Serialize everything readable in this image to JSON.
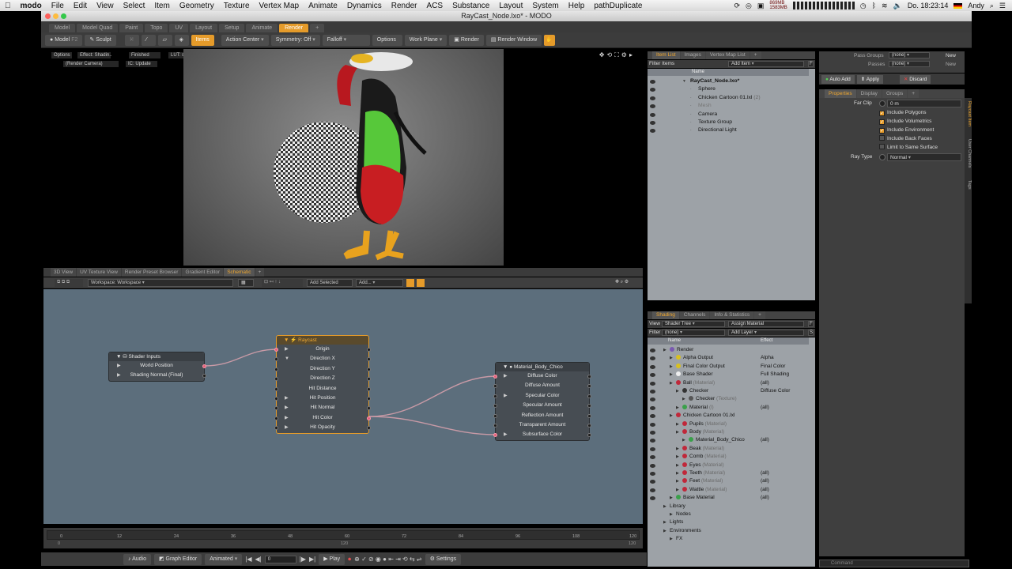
{
  "menubar": {
    "app": "modo",
    "items": [
      "File",
      "Edit",
      "View",
      "Select",
      "Item",
      "Geometry",
      "Texture",
      "Vertex Map",
      "Animate",
      "Dynamics",
      "Render",
      "ACS",
      "Substance",
      "Layout",
      "System",
      "Help",
      "pathDuplicate"
    ],
    "stat_top": "869MB",
    "stat_bottom": "1583MB",
    "clock": "Do. 18:23:14",
    "user": "Andy"
  },
  "window": {
    "title": "RayCast_Node.lxo* - MODO"
  },
  "mode_tabs": [
    "Model",
    "Model Quad",
    "Paint",
    "Topo",
    "UV",
    "Layout",
    "Setup",
    "Animate",
    "Render"
  ],
  "toolbar": {
    "model": "Model",
    "model_key": "F2",
    "sculpt": "Sculpt",
    "items": "Items",
    "action_center": "Action Center",
    "symmetry": "Symmetry: Off",
    "falloff": "Falloff",
    "options": "Options",
    "work_plane": "Work Plane",
    "render": "Render",
    "render_window": "Render Window"
  },
  "viewport": {
    "options": "Options",
    "effect": "Effect: Shadin..",
    "finished": "Finished",
    "lut": "LUT: sRGB",
    "camera": "(Render Camera)",
    "ic": "IC: Update"
  },
  "schematic_tabs": [
    "3D View",
    "UV Texture View",
    "Render Preset Browser",
    "Gradient Editor",
    "Schematic"
  ],
  "schematic_toolbar": {
    "workspace": "Workspace: Workspace",
    "add_selected": "Add Selected",
    "add": "Add..."
  },
  "nodes": {
    "shader_inputs": {
      "title": "Shader Inputs",
      "rows": [
        "World Position",
        "Shading Normal (Final)"
      ]
    },
    "raycast": {
      "title": "Raycast",
      "rows": [
        "Origin",
        "Direction X",
        "Direction Y",
        "Direction Z",
        "Hit Distance",
        "Hit Position",
        "Hit Normal",
        "Hit Color",
        "Hit Opacity"
      ]
    },
    "material": {
      "title": "Material_Body_Chico",
      "rows": [
        "Diffuse Color",
        "Diffuse Amount",
        "Specular Color",
        "Specular Amount",
        "Reflection Amount",
        "Transparent Amount",
        "Subsurface Color"
      ]
    }
  },
  "timeline": {
    "ticks": [
      "0",
      "12",
      "24",
      "36",
      "48",
      "60",
      "72",
      "84",
      "96",
      "108",
      "120"
    ],
    "bottom_ticks": [
      "0",
      "120",
      "120"
    ]
  },
  "transport": {
    "audio": "Audio",
    "graph_editor": "Graph Editor",
    "animated": "Animated",
    "frame": "0",
    "play": "Play",
    "settings": "Settings"
  },
  "item_list": {
    "tabs": [
      "Item List",
      "Images",
      "Vertex Map List"
    ],
    "filter": "Filter Items",
    "add_item": "Add Item",
    "name_header": "Name",
    "rows": [
      {
        "name": "RayCast_Node.lxo*",
        "sub": "",
        "bold": true,
        "indent": 0
      },
      {
        "name": "Sphere",
        "sub": "",
        "indent": 1
      },
      {
        "name": "Chicken Cartoon 01.lxl",
        "sub": "(2)",
        "indent": 1
      },
      {
        "name": "Mesh",
        "sub": "",
        "indent": 1,
        "dim": true
      },
      {
        "name": "Camera",
        "sub": "",
        "indent": 1
      },
      {
        "name": "Texture Group",
        "sub": "",
        "indent": 1
      },
      {
        "name": "Directional Light",
        "sub": "",
        "indent": 1
      }
    ]
  },
  "shading": {
    "tabs": [
      "Shading",
      "Channels",
      "Info & Statistics"
    ],
    "view_label": "View",
    "view_value": "Shader Tree",
    "assign": "Assign Material",
    "filter_label": "Filter",
    "filter_value": "(none)",
    "add_layer": "Add Layer",
    "name_header": "Name",
    "effect_header": "Effect",
    "rows": [
      {
        "name": "Render",
        "sub": "",
        "effect": "",
        "indent": 0,
        "color": "#7a5ab0"
      },
      {
        "name": "Alpha Output",
        "sub": "",
        "effect": "Alpha",
        "indent": 1,
        "color": "#d9c020"
      },
      {
        "name": "Final Color Output",
        "sub": "",
        "effect": "Final Color",
        "indent": 1,
        "color": "#d9c020"
      },
      {
        "name": "Base Shader",
        "sub": "",
        "effect": "Full Shading",
        "indent": 1,
        "color": "#eeeeee"
      },
      {
        "name": "Ball",
        "sub": "(Material)",
        "effect": "(all)",
        "indent": 1,
        "color": "#c0283a"
      },
      {
        "name": "Checker",
        "sub": "",
        "effect": "Diffuse Color",
        "indent": 2,
        "color": "#333333"
      },
      {
        "name": "Checker",
        "sub": "(Texture)",
        "effect": "",
        "indent": 3,
        "color": "#555555"
      },
      {
        "name": "Material",
        "sub": "(l)",
        "effect": "(all)",
        "indent": 2,
        "color": "#3aa04a"
      },
      {
        "name": "Chicken Cartoon 01.lxl",
        "sub": "",
        "effect": "",
        "indent": 1,
        "color": "#c0283a"
      },
      {
        "name": "Pupils",
        "sub": "(Material)",
        "effect": "",
        "indent": 2,
        "color": "#c0283a"
      },
      {
        "name": "Body",
        "sub": "(Material)",
        "effect": "",
        "indent": 2,
        "color": "#c0283a"
      },
      {
        "name": "Material_Body_Chico",
        "sub": "",
        "effect": "(all)",
        "indent": 3,
        "color": "#3aa04a"
      },
      {
        "name": "Beak",
        "sub": "(Material)",
        "effect": "",
        "indent": 2,
        "color": "#c0283a"
      },
      {
        "name": "Comb",
        "sub": "(Material)",
        "effect": "",
        "indent": 2,
        "color": "#c0283a"
      },
      {
        "name": "Eyes",
        "sub": "(Material)",
        "effect": "",
        "indent": 2,
        "color": "#c0283a"
      },
      {
        "name": "Teeth",
        "sub": "(Material)",
        "effect": "(all)",
        "indent": 2,
        "color": "#c0283a"
      },
      {
        "name": "Feet",
        "sub": "(Material)",
        "effect": "(all)",
        "indent": 2,
        "color": "#c0283a"
      },
      {
        "name": "Wattle",
        "sub": "(Material)",
        "effect": "(all)",
        "indent": 2,
        "color": "#c0283a"
      },
      {
        "name": "Base Material",
        "sub": "",
        "effect": "(all)",
        "indent": 1,
        "color": "#3aa04a"
      },
      {
        "name": "Library",
        "sub": "",
        "effect": "",
        "indent": 0,
        "color": ""
      },
      {
        "name": "Nodes",
        "sub": "",
        "effect": "",
        "indent": 1,
        "color": ""
      },
      {
        "name": "Lights",
        "sub": "",
        "effect": "",
        "indent": 0,
        "color": ""
      },
      {
        "name": "Environments",
        "sub": "",
        "effect": "",
        "indent": 0,
        "color": ""
      },
      {
        "name": "FX",
        "sub": "",
        "effect": "",
        "indent": 1,
        "color": ""
      }
    ]
  },
  "properties": {
    "pass_groups": "Pass Groups",
    "passes": "Passes",
    "none": "(none)",
    "new": "New",
    "auto_add": "Auto Add",
    "apply": "Apply",
    "discard": "Discard",
    "tabs": [
      "Properties",
      "Display",
      "Groups"
    ],
    "far_clip_label": "Far Clip",
    "far_clip_value": "0 m",
    "checks": [
      {
        "label": "Include Polygons",
        "on": true
      },
      {
        "label": "Include Volumetrics",
        "on": true
      },
      {
        "label": "Include Environment",
        "on": true
      },
      {
        "label": "Include Back Faces",
        "on": false
      },
      {
        "label": "Limit to Same Surface",
        "on": false
      }
    ],
    "ray_type_label": "Ray Type",
    "ray_type_value": "Normal",
    "side_tabs": [
      "Raycast Item",
      "User Channels",
      "Tags"
    ],
    "command": "Command"
  },
  "colors": {
    "accent": "#e59b2a",
    "schematic_bg": "#5c6e7c",
    "wire": "#c89aa6"
  }
}
